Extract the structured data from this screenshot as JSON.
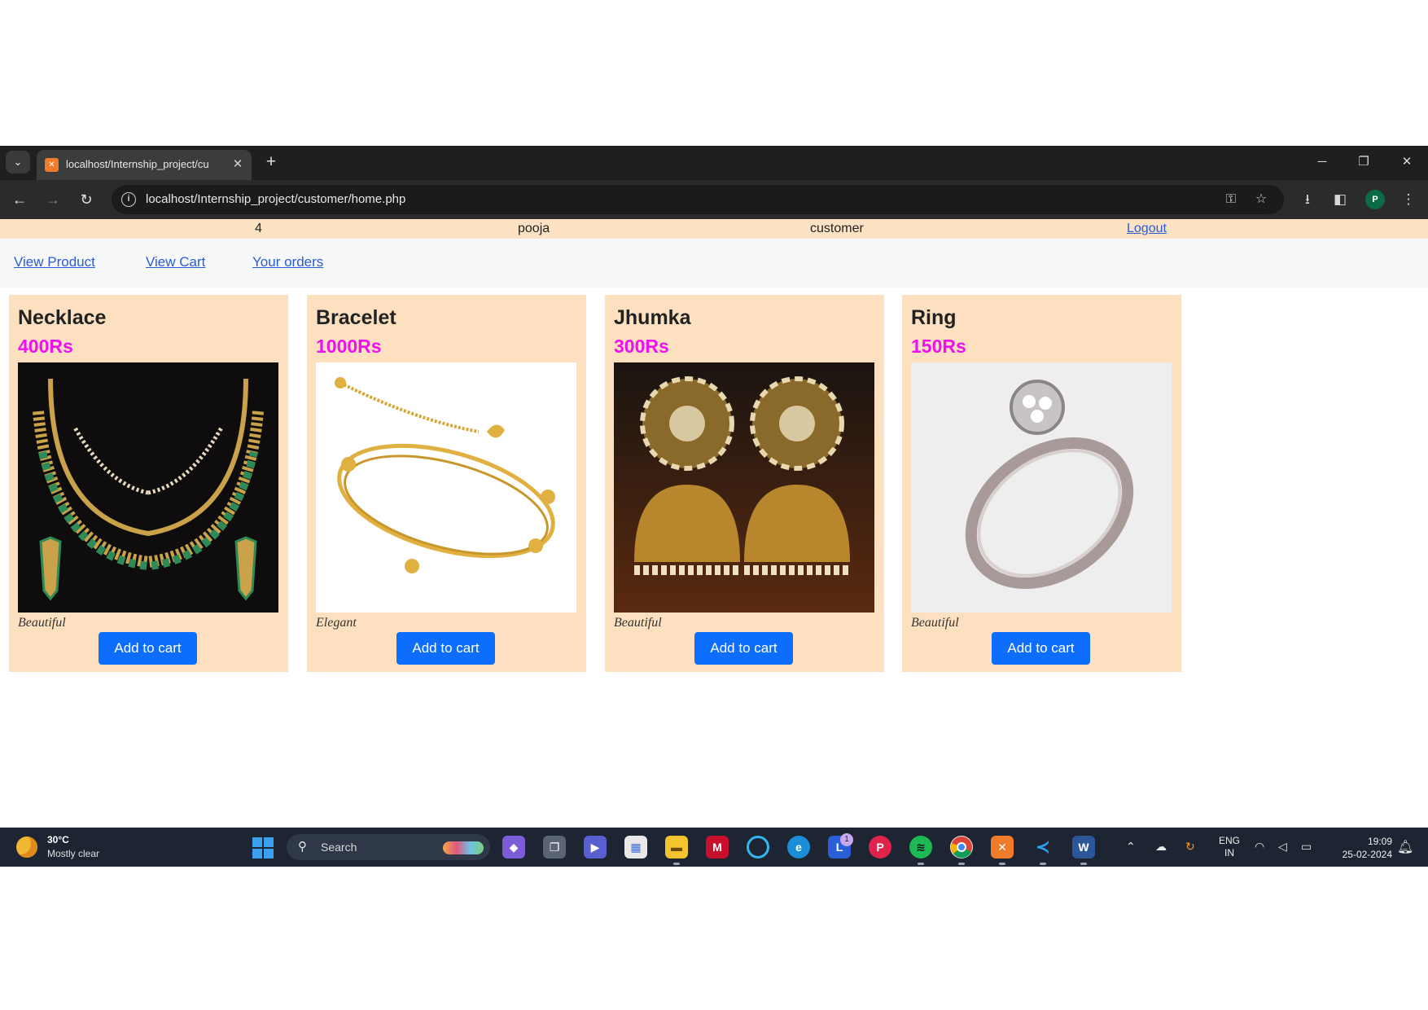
{
  "browser": {
    "tab_title": "localhost/Internship_project/cu",
    "tab_icon": "xampp-icon",
    "url": "localhost/Internship_project/customer/home.php",
    "profile_initial": "P"
  },
  "userbar": {
    "id": "4",
    "username": "pooja",
    "role": "customer",
    "logout_label": "Logout"
  },
  "nav": {
    "view_product": "View Product",
    "view_cart": "View Cart",
    "your_orders": "Your orders"
  },
  "products": [
    {
      "name": "Necklace",
      "price": "400Rs",
      "description": "Beautiful",
      "button": "Add to cart",
      "image": "necklace-image"
    },
    {
      "name": "Bracelet",
      "price": "1000Rs",
      "description": "Elegant",
      "button": "Add to cart",
      "image": "bracelet-image"
    },
    {
      "name": "Jhumka",
      "price": "300Rs",
      "description": "Beautiful",
      "button": "Add to cart",
      "image": "jhumka-image"
    },
    {
      "name": "Ring",
      "price": "150Rs",
      "description": "Beautiful",
      "button": "Add to cart",
      "image": "ring-image"
    }
  ],
  "taskbar": {
    "temperature": "30°C",
    "weather": "Mostly clear",
    "search_label": "Search",
    "notification_count": "1",
    "lang_line1": "ENG",
    "lang_line2": "IN",
    "time": "19:09",
    "date": "25-02-2024"
  },
  "colors": {
    "card_bg": "#fde0bf",
    "price": "#ee10ee",
    "button": "#0d6efd",
    "link": "#2a5bd7"
  }
}
